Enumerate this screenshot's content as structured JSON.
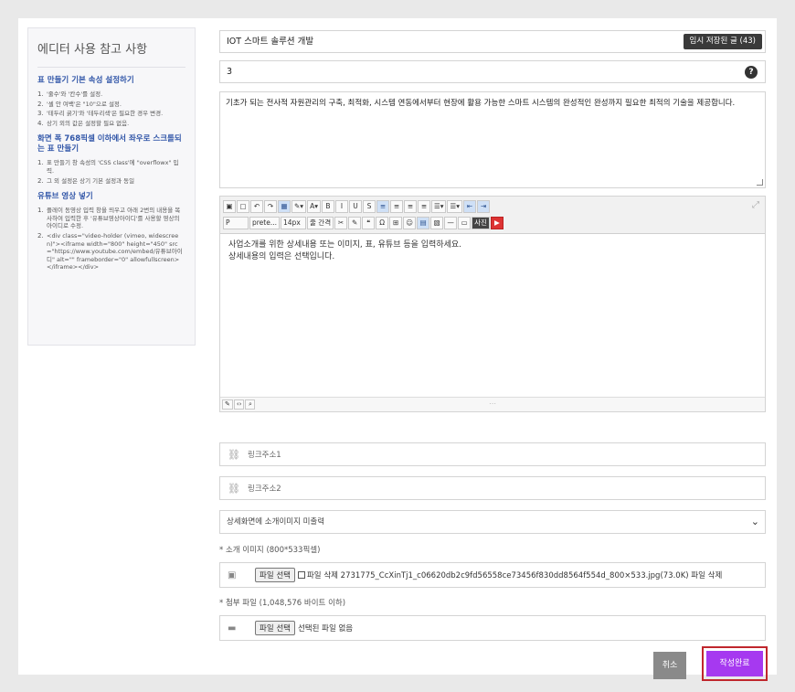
{
  "sidebar": {
    "title": "에디터 사용 참고 사항",
    "sections": [
      {
        "heading": "표 만들기 기본 속성 설정하기",
        "items": [
          "'줄수'와 '칸수'를 설정.",
          "'셀 안 여백'은 \"10\"으로 설정.",
          "'테두리 굵기'와 '테두리색'은 필요한 경우 변경.",
          "상기 외의 값은 설정할 필요 없음."
        ]
      },
      {
        "heading": "화면 폭 768픽셀 이하에서 좌우로 스크롤되는 표 만들기",
        "items": [
          "표 만들기 창 속성의 'CSS class'에 \"overflowx\" 입력.",
          "그 외 설정은 상기 기본 설정과 동일"
        ]
      },
      {
        "heading": "유튜브 영상 넣기",
        "items": [
          "플레이 동영상 입력 창을 띄우고 아래 2번의 내용을 복사하여 입력한 후 '유튜브영상아이디'를 사용할 영상의 아이디로 수정.",
          "<div class=\"video-holder (vimeo, widescreen)\"><iframe width=\"800\" height=\"450\" src=\"https://www.youtube.com/embed/유튜브아이디\" alt=\"\" frameborder=\"0\" allowfullscreen></iframe></div>"
        ]
      }
    ]
  },
  "form": {
    "title_value": "IOT 스마트 솔루션 개발",
    "draft_button": "임시 저장된 글 (43)",
    "number_value": "3",
    "help_label": "?",
    "description": "기초가 되는 전사적 자원관리의 구축, 최적화, 시스템 연동에서부터 현장에 활용 가능한 스마트 시스템의 완성적인 완성까지 필요한 최적의 기술을 제공합니다.",
    "editor": {
      "placeholder_line1": "사업소개를 위한 상세내용 또는 이미지, 표, 유튜브 등을 입력하세요.",
      "placeholder_line2": "상세내용의 입력은 선택입니다.",
      "toolbar_row1": [
        "▣",
        "▢",
        "↶",
        "↷",
        "▦",
        "✎▾",
        "A▾",
        "B",
        "I",
        "U",
        "S",
        "≡",
        "≡",
        "≡",
        "≡",
        "☰▾",
        "☰▾",
        "⇤",
        "⇥"
      ],
      "format_select": "P",
      "font_select": "prete...",
      "size_select": "14px",
      "line_select": "줄 간격",
      "toolbar_row2": [
        "✂",
        "✎",
        "❝",
        "Ω",
        "⊞",
        "☺",
        "▤",
        "▧",
        "—",
        "▭"
      ],
      "photo_button": "사진",
      "youtube_icon": "▶"
    },
    "link1_placeholder": "링크주소1",
    "link2_placeholder": "링크주소2",
    "select_value": "상세화면에 소개이미지 미출력",
    "image_label": "* 소개 이미지 (800*533픽셀)",
    "image_file_button": "파일 선택",
    "image_file_text": "파일 삭제 2731775_CcXinTj1_c06620db2c9fd56558ce73456f830dd8564f554d_800×533.jpg(73.0K) 파일 삭제",
    "attach_label": "* 첨부 파일 (1,048,576 바이트 이하)",
    "attach_file_button": "파일 선택",
    "attach_file_text": "선택된 파일 없음",
    "cancel_button": "취소",
    "submit_button": "작성완료"
  },
  "colors": {
    "submit": "#a639f0",
    "highlight_border": "#c0272d",
    "heading_blue": "#3156a8"
  }
}
